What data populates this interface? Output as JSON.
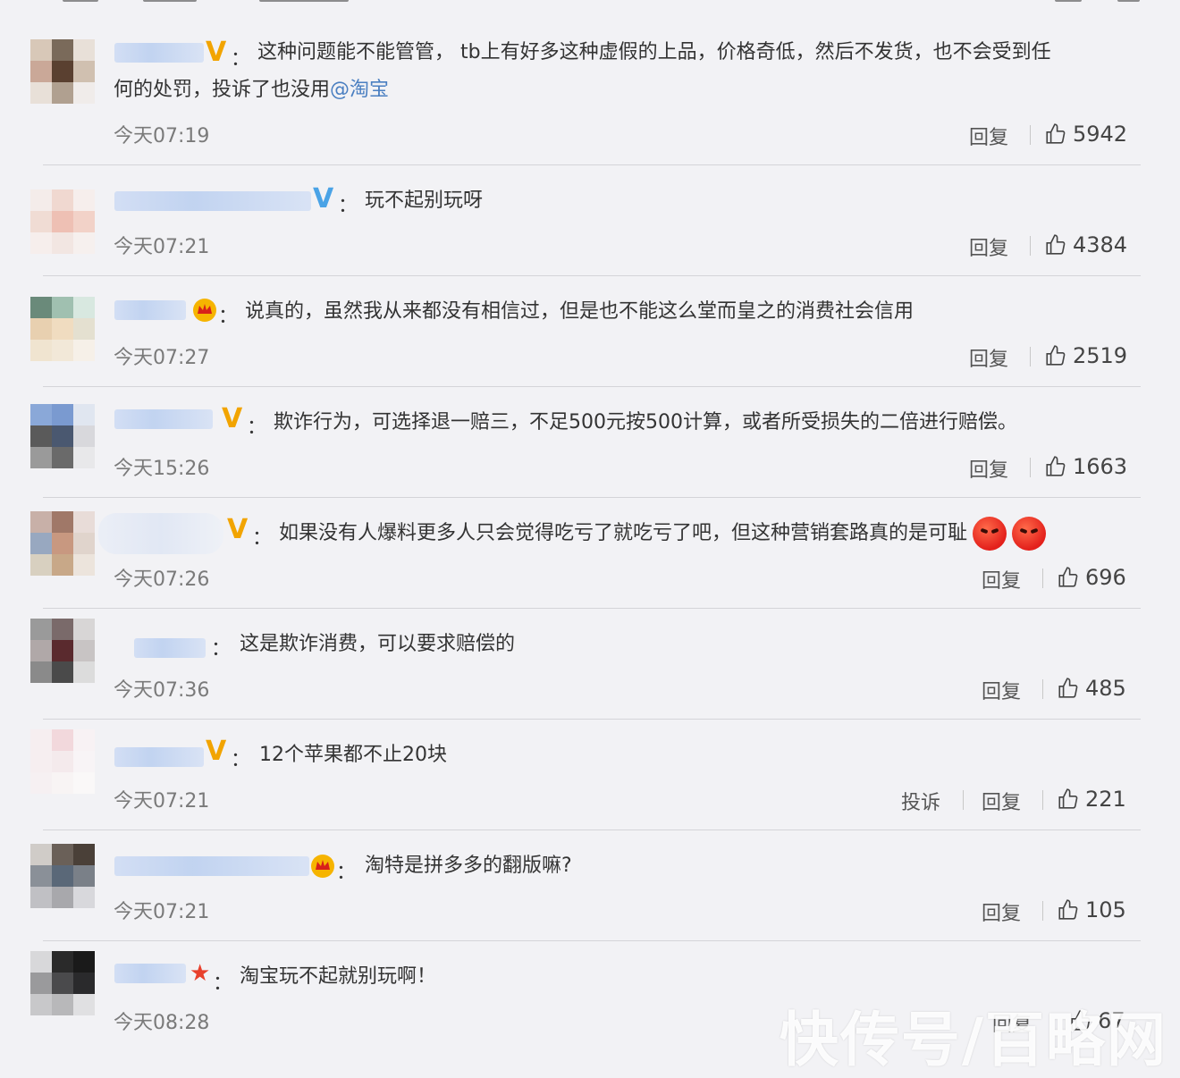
{
  "actions": {
    "reply": "回复",
    "report": "投诉"
  },
  "watermark": "快传号/百略网",
  "comments": [
    {
      "badge": "v-gold",
      "text_line1": "这种问题能不能管管， tb上有好多这种虚假的上品，价格奇低，然后不发货，也不会受到任",
      "text_line2_pre": "何的处罚，投诉了也没用",
      "mention": "@淘宝",
      "time": "今天07:19",
      "likes": "5942"
    },
    {
      "badge": "v-blue",
      "text": "玩不起别玩呀",
      "time": "今天07:21",
      "likes": "4384"
    },
    {
      "badge": "crown",
      "text": "说真的，虽然我从来都没有相信过，但是也不能这么堂而皇之的消费社会信用",
      "time": "今天07:27",
      "likes": "2519"
    },
    {
      "badge": "v-gold",
      "text": "欺诈行为，可选择退一赔三，不足500元按500计算，或者所受损失的二倍进行赔偿。",
      "time": "今天15:26",
      "likes": "1663"
    },
    {
      "badge": "v-gold",
      "text": "如果没有人爆料更多人只会觉得吃亏了就吃亏了吧，但这种营销套路真的是可耻",
      "time": "今天07:26",
      "likes": "696"
    },
    {
      "badge": "none",
      "text": "这是欺诈消费，可以要求赔偿的",
      "time": "今天07:36",
      "likes": "485"
    },
    {
      "badge": "v-gold",
      "text": "12个苹果都不止20块",
      "time": "今天07:21",
      "likes": "221"
    },
    {
      "badge": "crown",
      "text": "淘特是拼多多的翻版嘛?",
      "time": "今天07:21",
      "likes": "105"
    },
    {
      "badge": "star",
      "text": "淘宝玩不起就别玩啊！",
      "time": "今天08:28",
      "likes": "67"
    }
  ]
}
